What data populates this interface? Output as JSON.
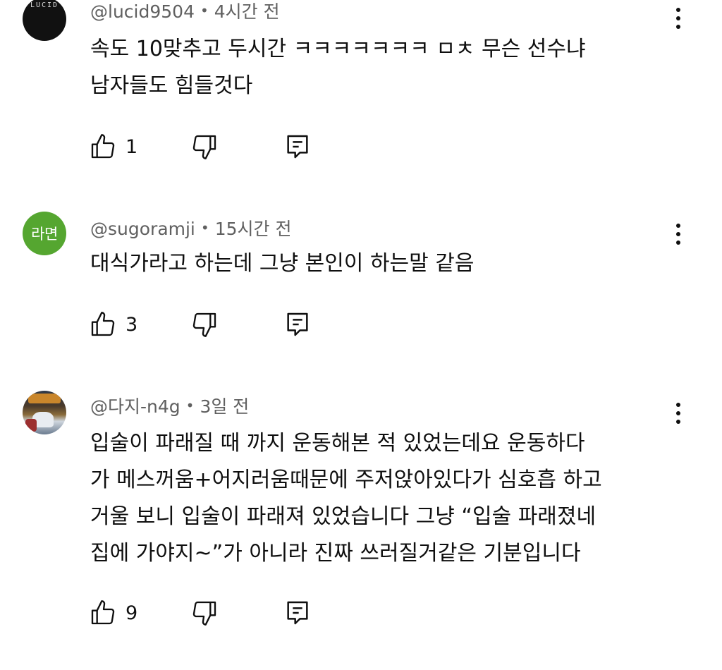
{
  "comments": [
    {
      "handle": "@lucid9504",
      "time": "4시간 전",
      "avatar": {
        "type": "logo",
        "text": "LUCID",
        "color": "#111111"
      },
      "text": "속도 10맞추고 두시간 ㅋㅋㅋㅋㅋㅋㅋ ㅁㅊ 무슨 선수냐\n남자들도 힘들것다",
      "likes": "1"
    },
    {
      "handle": "@sugoramji",
      "time": "15시간 전",
      "avatar": {
        "type": "text",
        "text": "라면",
        "color": "#55a630"
      },
      "text": "대식가라고 하는데 그냥 본인이 하는말 같음",
      "likes": "3"
    },
    {
      "handle": "@다지-n4g",
      "time": "3일 전",
      "avatar": {
        "type": "photo"
      },
      "text": "입술이 파래질 때 까지 운동해본 적 있었는데요 운동하다\n가 메스꺼움+어지러움때문에 주저앉아있다가 심호흡 하고\n거울 보니 입술이 파래져 있었습니다 그냥 “입술 파래졌네\n집에 가야지~”가 아니라 진짜 쓰러질거같은 기분입니다",
      "likes": "9"
    }
  ],
  "separator": "•",
  "icons": {
    "like": "thumb-up-icon",
    "dislike": "thumb-down-icon",
    "reply": "reply-icon",
    "menu": "more-vert-icon"
  },
  "colors": {
    "text": "#0f0f0f",
    "meta": "#606060",
    "background": "#ffffff"
  }
}
